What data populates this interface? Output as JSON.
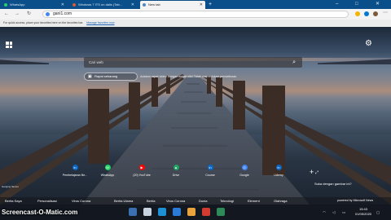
{
  "tabs": [
    {
      "label": "WhatsApp",
      "color": "#25d366"
    },
    {
      "label": "Windows 7 ITS on dalis (Tab...",
      "color": "#e05a2c"
    },
    {
      "label": "New tab",
      "color": "#4d88c9"
    }
  ],
  "newtab_glyph": "+",
  "window_controls": [
    "–",
    "□",
    "✕"
  ],
  "address": {
    "value": "gani1.com"
  },
  "favorites_notice": {
    "text": "For quick access, place your favorites here on the favorites bar.",
    "link": "Manage favorites now"
  },
  "search": {
    "placeholder": "Cari web"
  },
  "quick_button": {
    "label": "Rapat sekarang"
  },
  "promo_text": "Adakan rapat video dengan sekali klik! Tidak memerlukan pendaftaran.",
  "top_sites": [
    {
      "label": "Pembelajaran Be...",
      "icon_text": "in",
      "color": "#0a66c2"
    },
    {
      "label": "WhatsApp",
      "icon_text": "W",
      "color": "#25d366"
    },
    {
      "label": "(20) YouTube",
      "icon_text": "▶",
      "color": "#ff0000"
    },
    {
      "label": "Drive",
      "icon_text": "▲",
      "color": "#1fa463"
    },
    {
      "label": "Course",
      "icon_text": "in",
      "color": "#0a66c2"
    },
    {
      "label": "Google",
      "icon_text": "G",
      "color": "#4285f4"
    },
    {
      "label": "Udemy",
      "icon_text": "in",
      "color": "#0a66c2"
    }
  ],
  "add_site": "+",
  "like_image": "Suka dengan gambar ini?",
  "expand_glyph": "⤢",
  "news_tabs": [
    "Berita Saya",
    "Personalisasi",
    "Virus Corona",
    "Berita Utama",
    "Berita",
    "Virus Corona",
    "Dunia",
    "Teknologi",
    "Element",
    "Olahraga"
  ],
  "powered_by": "powered by Microsoft News",
  "image_credit": "Hanging flames",
  "clock": {
    "time": "15:43",
    "date": "01/05/2020"
  },
  "watermark": "Screencast-O-Matic.com"
}
